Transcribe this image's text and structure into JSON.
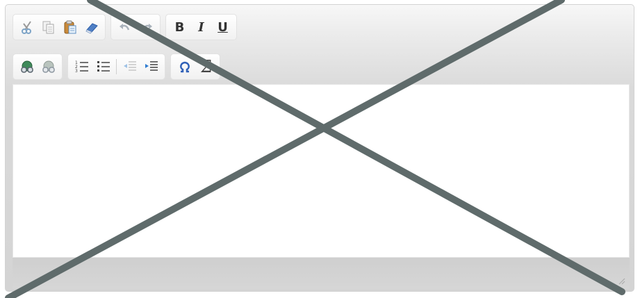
{
  "toolbar": {
    "row1": {
      "clipboard": [
        "cut-icon",
        "copy-icon",
        "paste-icon",
        "eraser-icon"
      ],
      "history": [
        "undo-icon",
        "redo-icon"
      ],
      "format": {
        "bold_label": "B",
        "italic_label": "I",
        "underline_label": "U"
      }
    },
    "row2": {
      "links": [
        "link-icon",
        "unlink-icon"
      ],
      "lists": [
        "ordered-list-icon",
        "unordered-list-icon",
        "outdent-icon",
        "indent-icon"
      ],
      "insert": {
        "special_char_icon": "special-char-icon",
        "sigma_label": "Σ"
      }
    }
  },
  "editor": {
    "content": ""
  },
  "overlay": {
    "stroke_color": "#5f6b6b"
  }
}
